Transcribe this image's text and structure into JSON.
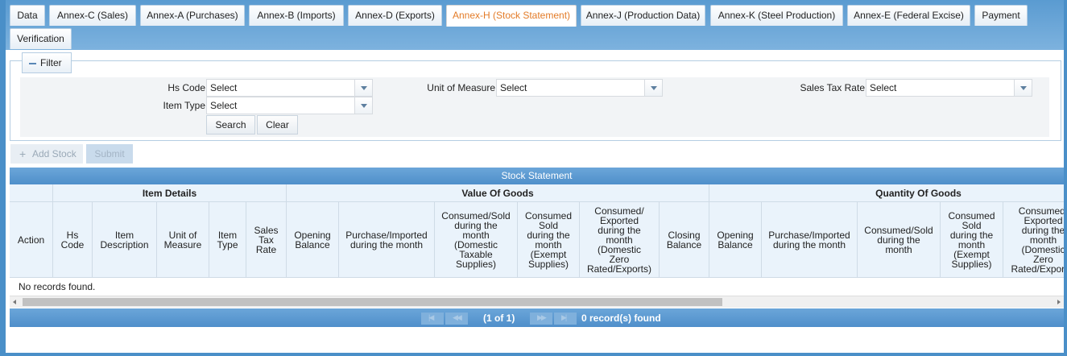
{
  "tabs": [
    {
      "label": "Data",
      "active": false
    },
    {
      "label": "Annex-C (Sales)",
      "active": false
    },
    {
      "label": "Annex-A (Purchases)",
      "active": false
    },
    {
      "label": "Annex-B (Imports)",
      "active": false
    },
    {
      "label": "Annex-D (Exports)",
      "active": false
    },
    {
      "label": "Annex-H (Stock Statement)",
      "active": true
    },
    {
      "label": "Annex-J (Production Data)",
      "active": false
    },
    {
      "label": "Annex-K (Steel Production)",
      "active": false
    },
    {
      "label": "Annex-E (Federal Excise)",
      "active": false
    },
    {
      "label": "Payment",
      "active": false
    },
    {
      "label": "Verification",
      "active": false
    }
  ],
  "filter": {
    "legend": "Filter",
    "hs_code": {
      "label": "Hs Code",
      "value": "Select"
    },
    "unit_of_measure": {
      "label": "Unit of Measure",
      "value": "Select"
    },
    "sales_tax_rate": {
      "label": "Sales Tax Rate",
      "value": "Select"
    },
    "item_type": {
      "label": "Item Type",
      "value": "Select"
    },
    "search_label": "Search",
    "clear_label": "Clear"
  },
  "toolbar": {
    "add_stock_label": "Add Stock",
    "submit_label": "Submit"
  },
  "grid": {
    "title": "Stock Statement",
    "groups": {
      "item_details": "Item Details",
      "value_of_goods": "Value Of Goods",
      "quantity_of_goods": "Quantity Of Goods"
    },
    "columns": [
      "Action",
      "Hs\nCode",
      "Item\nDescription",
      "Unit of\nMeasure",
      "Item\nType",
      "Sales\nTax\nRate",
      "Opening\nBalance",
      "Purchase/Imported\nduring the month",
      "Consumed/Sold\nduring the\nmonth\n(Domestic\nTaxable\nSupplies)",
      "Consumed\nSold\nduring the\nmonth\n(Exempt\nSupplies)",
      "Consumed/\nExported\nduring the\nmonth\n(Domestic\nZero\nRated/Exports)",
      "Closing\nBalance",
      "Opening\nBalance",
      "Purchase/Imported\nduring the month",
      "Consumed/Sold\nduring the\nmonth",
      "Consumed\nSold\nduring the\nmonth\n(Exempt\nSupplies)",
      "Consumed/\nExported\nduring the\nmonth\n(Domestic\nZero\nRated/Exports)"
    ],
    "empty_message": "No records found.",
    "pager": {
      "current": "(1 of 1)",
      "count": "0 record(s) found"
    }
  }
}
